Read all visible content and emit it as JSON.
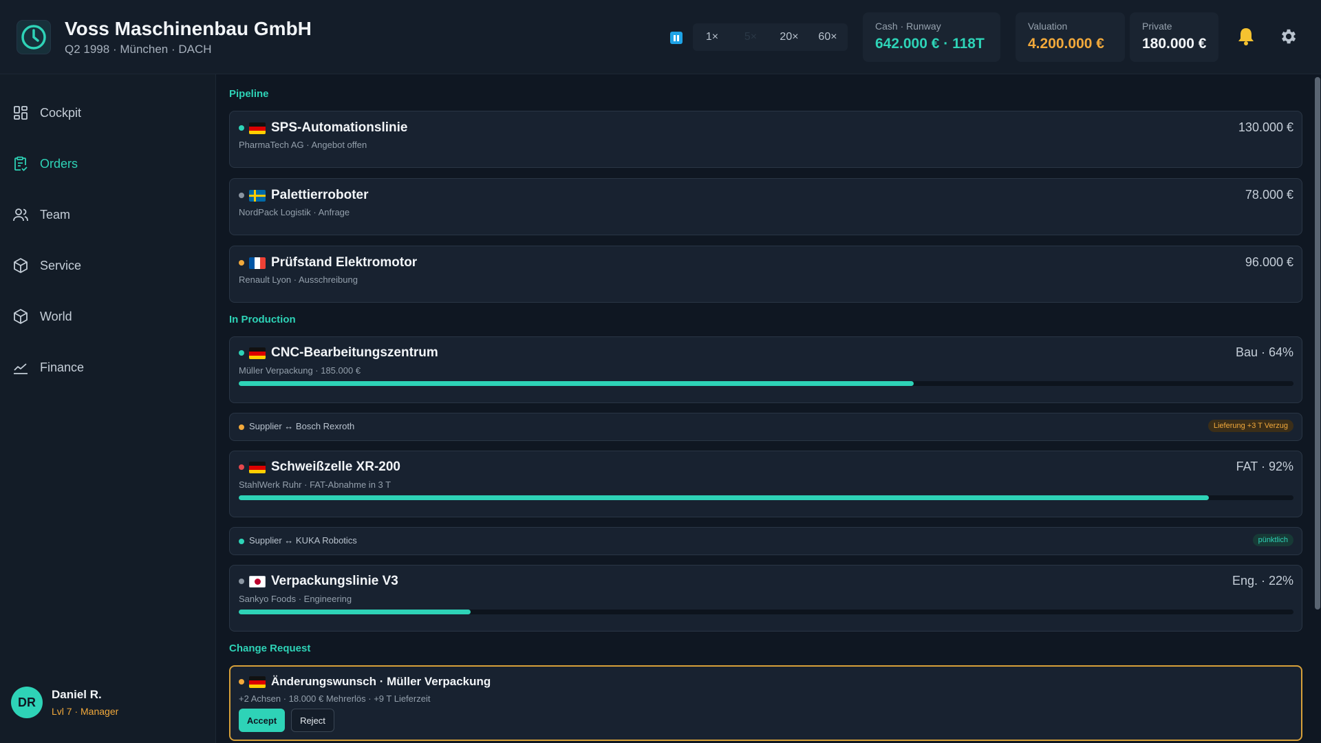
{
  "header": {
    "company_name": "Voss Maschinenbau GmbH",
    "company_sub": "Q2 1998 · München · DACH",
    "speeds": [
      "1×",
      "5×",
      "20×",
      "60×"
    ],
    "active_speed": "5×",
    "cash_label": "Cash · Runway",
    "cash_value": "642.000 €  ·  118T",
    "valuation_label": "Valuation",
    "valuation_value": "4.200.000 €",
    "private_label": "Private",
    "private_value": "180.000 €"
  },
  "sidebar": {
    "items": [
      {
        "label": "Cockpit",
        "icon": "grid-icon"
      },
      {
        "label": "Orders",
        "icon": "clipboard-check-icon",
        "active": true
      },
      {
        "label": "Team",
        "icon": "people-icon"
      },
      {
        "label": "Service",
        "icon": "box-icon"
      },
      {
        "label": "World",
        "icon": "box-icon"
      },
      {
        "label": "Finance",
        "icon": "chart-line-icon"
      }
    ],
    "user": {
      "initials": "DR",
      "name": "Daniel R.",
      "role": "Lvl 7 · Manager"
    }
  },
  "sections": {
    "pipeline": "Pipeline",
    "production": "In Production",
    "change_request": "Change Request"
  },
  "pipeline": [
    {
      "title": "SPS-Automationslinie",
      "sub": "PharmaTech AG · Angebot offen",
      "value": "130.000 €",
      "flag": "de",
      "status": "teal"
    },
    {
      "title": "Palettierroboter",
      "sub": "NordPack Logistik · Anfrage",
      "value": "78.000 €",
      "flag": "se",
      "status": "gray"
    },
    {
      "title": "Prüfstand Elektromotor",
      "sub": "Renault Lyon · Ausschreibung",
      "value": "96.000 €",
      "flag": "fr",
      "status": "amber"
    }
  ],
  "production": [
    {
      "title": "CNC-Bearbeitungszentrum",
      "sub": "Müller Verpackung · 185.000 €",
      "status_text": "Bau · 64%",
      "progress": 0.64,
      "flag": "de",
      "status": "teal"
    },
    {
      "title": "Schweißzelle XR-200",
      "sub": "StahlWerk Ruhr · FAT-Abnahme in 3 T",
      "status_text": "FAT · 92%",
      "progress": 0.92,
      "flag": "de",
      "status": "red"
    },
    {
      "title": "Verpackungslinie V3",
      "sub": "Sankyo Foods · Engineering",
      "status_text": "Eng. · 22%",
      "progress": 0.22,
      "flag": "jp",
      "status": "gray"
    }
  ],
  "suppliers": [
    {
      "text": "Supplier ↔ Bosch Rexroth",
      "badge": "Lieferung +3 T Verzug",
      "status": "amber"
    },
    {
      "text": "Supplier ↔ KUKA Robotics",
      "badge": "pünktlich",
      "status": "teal"
    }
  ],
  "change_request": {
    "title": "Änderungswunsch · Müller Verpackung",
    "sub": "+2 Achsen · 18.000 € Mehrerlös · +9 T Lieferzeit",
    "accept": "Accept",
    "reject": "Reject",
    "flag": "de"
  },
  "colors": {
    "accent": "#2ed3b7",
    "warning": "#f2a93b",
    "danger": "#e5484d",
    "neutral": "#8a95a1"
  }
}
